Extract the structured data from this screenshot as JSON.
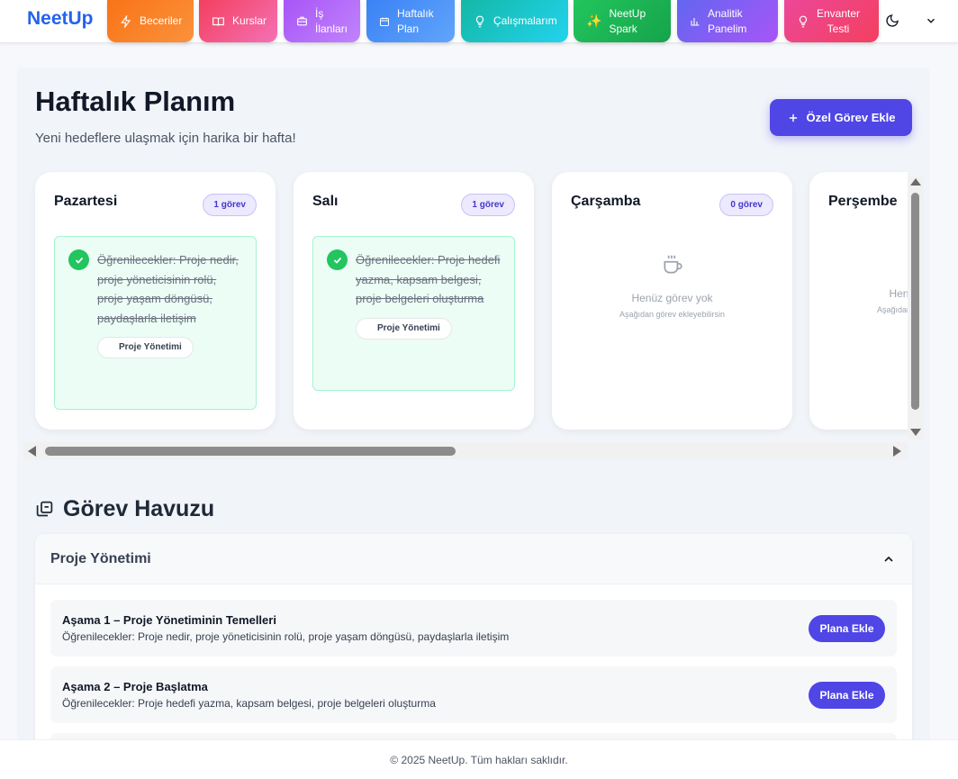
{
  "nav": {
    "brand": "NeetUp",
    "items": [
      {
        "label": "Beceriler",
        "icon": "bolt-icon",
        "color_from": "#f97316",
        "color_to": "#fb923c"
      },
      {
        "label": "Kurslar",
        "icon": "book-icon",
        "color_from": "#f43f5e",
        "color_to": "#f472b6"
      },
      {
        "label": "İş\nİlanları",
        "icon": "briefcase-icon",
        "color_from": "#a855f7",
        "color_to": "#c084fc"
      },
      {
        "label": "Haftalık\nPlan",
        "icon": "calendar-icon",
        "color_from": "#3b82f6",
        "color_to": "#60a5fa"
      },
      {
        "label": "Çalışmalarım",
        "icon": "lightbulb-icon",
        "color_from": "#14b8a6",
        "color_to": "#22d3ee"
      },
      {
        "label": "NeetUp\nSpark",
        "icon": "sparkles-icon",
        "color_from": "#22c55e",
        "color_to": "#16a34a"
      },
      {
        "label": "Analitik\nPanelim",
        "icon": "chart-icon",
        "color_from": "#6366f1",
        "color_to": "#a855f7"
      },
      {
        "label": "Envanter\nTesti",
        "icon": "lightbulb-icon",
        "color_from": "#ec4899",
        "color_to": "#f43f5e"
      }
    ]
  },
  "header": {
    "title": "Haftalık Planım",
    "subtitle": "Yeni hedeflere ulaşmak için harika bir hafta!",
    "add_button": "Özel Görev Ekle"
  },
  "week": {
    "days": [
      {
        "name": "Pazartesi",
        "count": "1 görev",
        "task": "Öğrenilecekler: Proje nedir, proje yöneticisinin rolü, proje yaşam döngüsü, paydaşlarla iletişim",
        "tag": "Proje Yönetimi",
        "completed": true
      },
      {
        "name": "Salı",
        "count": "1 görev",
        "task": "Öğrenilecekler: Proje hedefi yazma, kapsam belgesi, proje belgeleri oluşturma",
        "tag": "Proje Yönetimi",
        "completed": true
      },
      {
        "name": "Çarşamba",
        "count": "0 görev",
        "empty_title": "Henüz görev yok",
        "empty_sub": "Aşağıdan görev ekleyebilirsin"
      },
      {
        "name": "Perşembe",
        "empty_title": "Henüz görev yok",
        "empty_sub": "Aşağıdan görev ekleyebilirsin"
      }
    ]
  },
  "pool": {
    "title": "Görev Havuzu",
    "category": "Proje Yönetimi",
    "stages": [
      {
        "title": "Aşama 1 – Proje Yönetiminin Temelleri",
        "desc": "Öğrenilecekler: Proje nedir, proje yöneticisinin rolü, proje yaşam döngüsü, paydaşlarla iletişim",
        "button": "Plana Ekle"
      },
      {
        "title": "Aşama 2 – Proje Başlatma",
        "desc": "Öğrenilecekler: Proje hedefi yazma, kapsam belgesi, proje belgeleri oluşturma",
        "button": "Plana Ekle"
      }
    ]
  },
  "footer": {
    "text": "© 2025 NeetUp. Tüm hakları saklıdır."
  },
  "colors": {
    "accent": "#4f46e5",
    "brand": "#2563eb",
    "success": "#22c55e"
  }
}
